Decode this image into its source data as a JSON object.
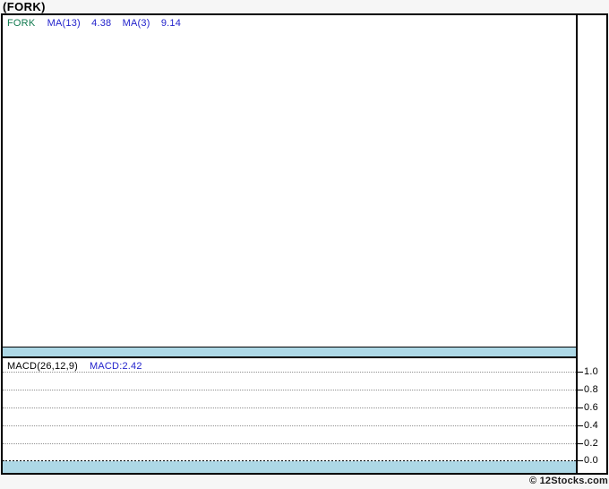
{
  "window": {
    "title": "(FORK)"
  },
  "main_panel": {
    "legend": {
      "symbol": "FORK",
      "ma1_label": "MA(13)",
      "ma1_value": "4.38",
      "ma2_label": "MA(3)",
      "ma2_value": "9.14"
    }
  },
  "macd_panel": {
    "legend": {
      "label": "MACD(26,12,9)",
      "value": "MACD:2.42"
    },
    "axis_ticks": [
      "1.0",
      "0.8",
      "0.6",
      "0.4",
      "0.2",
      "0.0"
    ]
  },
  "footer": {
    "copyright": "© 12Stocks.com"
  },
  "colors": {
    "symbol_green": "#117a4f",
    "indicator_blue": "#2323cc",
    "date_band_blue": "#add8e6",
    "grid_gray": "#909090",
    "background": "#f6f6f6"
  },
  "chart_data": [
    {
      "type": "line",
      "title": "FORK price panel with moving averages",
      "series": [
        {
          "name": "FORK",
          "values": []
        },
        {
          "name": "MA(13)",
          "latest": 4.38,
          "values": []
        },
        {
          "name": "MA(3)",
          "latest": 9.14,
          "values": []
        }
      ],
      "x": [],
      "legend_position": "top-left",
      "note": "plot area rendered empty — no price data visible"
    },
    {
      "type": "line",
      "title": "MACD(26,12,9)",
      "series": [
        {
          "name": "MACD",
          "latest": 2.42,
          "values": []
        }
      ],
      "x": [],
      "yticks": [
        1.0,
        0.8,
        0.6,
        0.4,
        0.2,
        0.0
      ],
      "ylim": [
        0.0,
        1.15
      ],
      "grid": true,
      "legend_position": "top-left",
      "note": "plot area rendered empty — no MACD line visible"
    }
  ]
}
